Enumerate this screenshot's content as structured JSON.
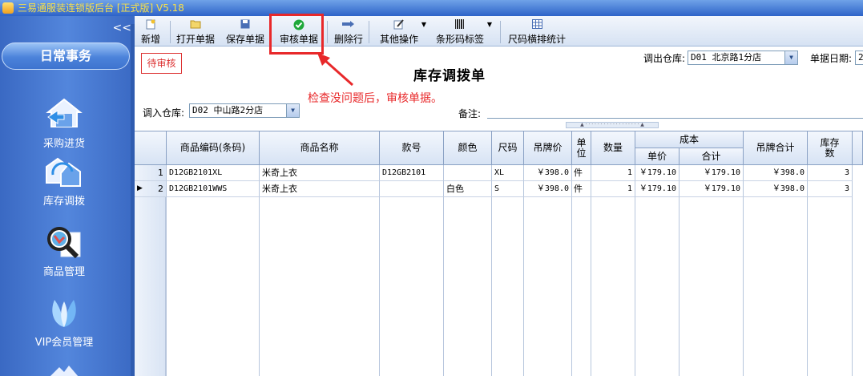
{
  "window": {
    "title": "三易通服装连锁版后台 [正式版] V5.18"
  },
  "sidebar": {
    "collapse_glyph": "<<",
    "section_title": "日常事务",
    "items": [
      {
        "label": "采购进货",
        "icon": "house-arrow-icon"
      },
      {
        "label": "库存调拨",
        "icon": "warehouse-transfer-icon"
      },
      {
        "label": "商品管理",
        "icon": "magnifier-icon"
      },
      {
        "label": "VIP会员管理",
        "icon": "leaf-icon"
      }
    ]
  },
  "toolbar": {
    "new": "新增",
    "open": "打开单据",
    "save": "保存单据",
    "audit": "审核单据",
    "delete_row": "删除行",
    "other": "其他操作",
    "barcode": "条形码标签",
    "size_stats": "尺码横排统计"
  },
  "form": {
    "status": "待审核",
    "title": "库存调拨单",
    "out_warehouse_label": "调出仓库:",
    "out_warehouse_value": "D01 北京路1分店",
    "date_label": "单据日期:",
    "date_value": "2",
    "in_warehouse_label": "调入仓库:",
    "in_warehouse_value": "D02 中山路2分店",
    "remark_label": "备注:",
    "remark_value": ""
  },
  "annotation": "检查没问题后，审核单据。",
  "grid": {
    "headers": {
      "code": "商品编码(条码)",
      "name": "商品名称",
      "style": "款号",
      "color": "颜色",
      "size": "尺码",
      "tag_price": "吊牌价",
      "unit": "单位",
      "qty": "数量",
      "cost": "成本",
      "cost_unit": "单价",
      "cost_total": "合计",
      "tag_total": "吊牌合计",
      "stock": "库存数"
    },
    "rows": [
      {
        "idx": "1",
        "marker": "",
        "code": "D12GB2101XL",
        "name": "米奇上衣",
        "style": "D12GB2101",
        "color": "",
        "size": "XL",
        "tag_price": "￥398.0",
        "unit": "件",
        "qty": "1",
        "cost_unit": "￥179.10",
        "cost_total": "￥179.10",
        "tag_total": "￥398.0",
        "stock": "3"
      },
      {
        "idx": "2",
        "marker": "▶",
        "code": "D12GB2101WWS",
        "name": "米奇上衣",
        "style": "",
        "color": "白色",
        "size": "S",
        "tag_price": "￥398.0",
        "unit": "件",
        "qty": "1",
        "cost_unit": "￥179.10",
        "cost_total": "￥179.10",
        "tag_total": "￥398.0",
        "stock": "3"
      }
    ]
  },
  "colors": {
    "sidebar": "#4a7bd0",
    "highlight": "#e8282a",
    "status": "#dd3333",
    "title_text": "#f8e04a"
  }
}
